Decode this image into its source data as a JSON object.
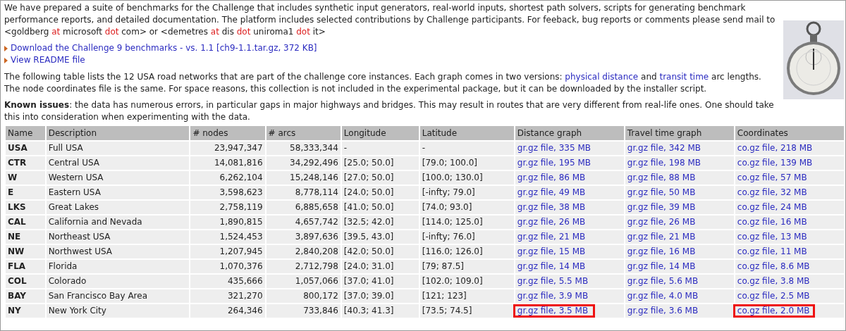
{
  "intro": [
    {
      "kind": "text",
      "text": "We have prepared a suite of benchmarks for the Challenge that includes synthetic input generators, real-world inputs, shortest path solvers, scripts for generating benchmark performance reports, and detailed documentation. The platform includes selected contributions by Challenge participants. For feeback, bug reports or comments please send mail to <goldberg "
    },
    {
      "kind": "red",
      "text": "at"
    },
    {
      "kind": "text",
      "text": " microsoft "
    },
    {
      "kind": "red",
      "text": "dot"
    },
    {
      "kind": "text",
      "text": " com> or <demetres "
    },
    {
      "kind": "red",
      "text": "at"
    },
    {
      "kind": "text",
      "text": " dis "
    },
    {
      "kind": "red",
      "text": "dot"
    },
    {
      "kind": "text",
      "text": " uniroma1 "
    },
    {
      "kind": "red",
      "text": "dot"
    },
    {
      "kind": "text",
      "text": " it>"
    }
  ],
  "downloads": [
    "Download the Challenge 9 benchmarks - vs. 1.1 [ch9-1.1.tar.gz, 372 KB]",
    "View README file"
  ],
  "table_intro": [
    {
      "kind": "text",
      "text": "The following table lists the 12 USA road networks that are part of the challenge core instances. Each graph comes in two versions: "
    },
    {
      "kind": "link",
      "text": "physical distance"
    },
    {
      "kind": "text",
      "text": " and "
    },
    {
      "kind": "link",
      "text": "transit time"
    },
    {
      "kind": "text",
      "text": " arc lengths. The node coordinates file is the same. For space reasons, this collection is not included in the experimental package, but it can be downloaded by the installer script."
    }
  ],
  "known_issues": "**Known issues**: the data has numerous errors, in particular gaps in major highways and bridges. This may result in routes that are very different from real-life ones. One should take this into consideration when experimenting with the data.",
  "table": {
    "columns": [
      "Name",
      "Description",
      "# nodes",
      "# arcs",
      "Longitude",
      "Latitude",
      "Distance graph",
      "Travel time graph",
      "Coordinates"
    ],
    "rows": [
      {
        "name": "USA",
        "description": "Full USA",
        "nodes": "23,947,347",
        "arcs": "58,333,344",
        "longitude": "-",
        "latitude": "-",
        "distance": {
          "text": "gr.gz file, 335 MB",
          "highlighted": false
        },
        "travel": {
          "text": "gr.gz file, 342 MB",
          "highlighted": false
        },
        "coordinates": {
          "text": "co.gz file, 218 MB",
          "highlighted": false
        }
      },
      {
        "name": "CTR",
        "description": "Central USA",
        "nodes": "14,081,816",
        "arcs": "34,292,496",
        "longitude": "[25.0; 50.0]",
        "latitude": "[79.0; 100.0]",
        "distance": {
          "text": "gr.gz file, 195 MB",
          "highlighted": false
        },
        "travel": {
          "text": "gr.gz file, 198 MB",
          "highlighted": false
        },
        "coordinates": {
          "text": "co.gz file, 139 MB",
          "highlighted": false
        }
      },
      {
        "name": "W",
        "description": "Western USA",
        "nodes": "6,262,104",
        "arcs": "15,248,146",
        "longitude": "[27.0; 50.0]",
        "latitude": "[100.0; 130.0]",
        "distance": {
          "text": "gr.gz file, 86 MB",
          "highlighted": false
        },
        "travel": {
          "text": "gr.gz file, 88 MB",
          "highlighted": false
        },
        "coordinates": {
          "text": "co.gz file, 57 MB",
          "highlighted": false
        }
      },
      {
        "name": "E",
        "description": "Eastern USA",
        "nodes": "3,598,623",
        "arcs": "8,778,114",
        "longitude": "[24.0; 50.0]",
        "latitude": "[-infty; 79.0]",
        "distance": {
          "text": "gr.gz file, 49 MB",
          "highlighted": false
        },
        "travel": {
          "text": "gr.gz file, 50 MB",
          "highlighted": false
        },
        "coordinates": {
          "text": "co.gz file, 32 MB",
          "highlighted": false
        }
      },
      {
        "name": "LKS",
        "description": "Great Lakes",
        "nodes": "2,758,119",
        "arcs": "6,885,658",
        "longitude": "[41.0; 50.0]",
        "latitude": "[74.0; 93.0]",
        "distance": {
          "text": "gr.gz file, 38 MB",
          "highlighted": false
        },
        "travel": {
          "text": "gr.gz file, 39 MB",
          "highlighted": false
        },
        "coordinates": {
          "text": "co.gz file, 24 MB",
          "highlighted": false
        }
      },
      {
        "name": "CAL",
        "description": "California and Nevada",
        "nodes": "1,890,815",
        "arcs": "4,657,742",
        "longitude": "[32.5; 42.0]",
        "latitude": "[114.0; 125.0]",
        "distance": {
          "text": "gr.gz file, 26 MB",
          "highlighted": false
        },
        "travel": {
          "text": "gr.gz file, 26 MB",
          "highlighted": false
        },
        "coordinates": {
          "text": "co.gz file, 16 MB",
          "highlighted": false
        }
      },
      {
        "name": "NE",
        "description": "Northeast USA",
        "nodes": "1,524,453",
        "arcs": "3,897,636",
        "longitude": "[39.5, 43.0]",
        "latitude": "[-infty; 76.0]",
        "distance": {
          "text": "gr.gz file, 21 MB",
          "highlighted": false
        },
        "travel": {
          "text": "gr.gz file, 21 MB",
          "highlighted": false
        },
        "coordinates": {
          "text": "co.gz file, 13 MB",
          "highlighted": false
        }
      },
      {
        "name": "NW",
        "description": "Northwest USA",
        "nodes": "1,207,945",
        "arcs": "2,840,208",
        "longitude": "[42.0; 50.0]",
        "latitude": "[116.0; 126.0]",
        "distance": {
          "text": "gr.gz file, 15 MB",
          "highlighted": false
        },
        "travel": {
          "text": "gr.gz file, 16 MB",
          "highlighted": false
        },
        "coordinates": {
          "text": "co.gz file, 11 MB",
          "highlighted": false
        }
      },
      {
        "name": "FLA",
        "description": "Florida",
        "nodes": "1,070,376",
        "arcs": "2,712,798",
        "longitude": "[24.0; 31.0]",
        "latitude": "[79; 87.5]",
        "distance": {
          "text": "gr.gz file, 14 MB",
          "highlighted": false
        },
        "travel": {
          "text": "gr.gz file, 14 MB",
          "highlighted": false
        },
        "coordinates": {
          "text": "co.gz file, 8.6 MB",
          "highlighted": false
        }
      },
      {
        "name": "COL",
        "description": "Colorado",
        "nodes": "435,666",
        "arcs": "1,057,066",
        "longitude": "[37.0; 41.0]",
        "latitude": "[102.0; 109.0]",
        "distance": {
          "text": "gr.gz file, 5.5 MB",
          "highlighted": false
        },
        "travel": {
          "text": "gr.gz file, 5.6 MB",
          "highlighted": false
        },
        "coordinates": {
          "text": "co.gz file, 3.8 MB",
          "highlighted": false
        }
      },
      {
        "name": "BAY",
        "description": "San Francisco Bay Area",
        "nodes": "321,270",
        "arcs": "800,172",
        "longitude": "[37.0; 39.0]",
        "latitude": "[121; 123]",
        "distance": {
          "text": "gr.gz file, 3.9 MB",
          "highlighted": false
        },
        "travel": {
          "text": "gr.gz file, 4.0 MB",
          "highlighted": false
        },
        "coordinates": {
          "text": "co.gz file, 2.5 MB",
          "highlighted": false
        }
      },
      {
        "name": "NY",
        "description": "New York City",
        "nodes": "264,346",
        "arcs": "733,846",
        "longitude": "[40.3; 41.3]",
        "latitude": "[73.5; 74.5]",
        "distance": {
          "text": "gr.gz file, 3.5 MB",
          "highlighted": true
        },
        "travel": {
          "text": "gr.gz file, 3.6 MB",
          "highlighted": false
        },
        "coordinates": {
          "text": "co.gz file, 2.0 MB",
          "highlighted": true
        }
      }
    ]
  }
}
